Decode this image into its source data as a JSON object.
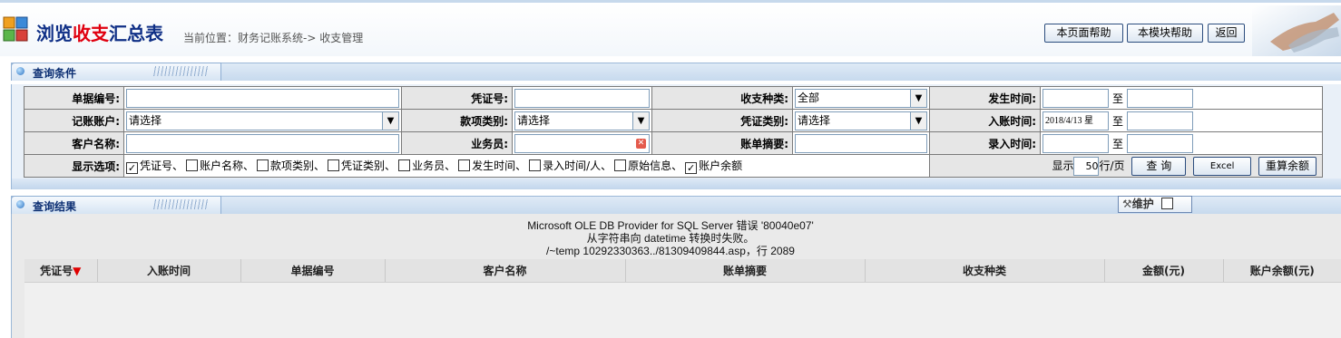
{
  "header": {
    "title_part1": "浏览",
    "title_part2": "收支",
    "title_part3": "汇总表",
    "breadcrumb": "当前位置：财务记账系统-> 收支管理",
    "buttons": {
      "page_help": "本页面帮助",
      "module_help": "本模块帮助",
      "back": "返回"
    }
  },
  "query": {
    "section_title": "查询条件",
    "labels": {
      "doc_no": "单据编号:",
      "voucher_no": "凭证号:",
      "io_type": "收支种类:",
      "occur_time": "发生时间:",
      "account": "记账账户:",
      "item_type": "款项类别:",
      "voucher_type": "凭证类别:",
      "post_time": "入账时间:",
      "customer": "客户名称:",
      "salesman": "业务员:",
      "summary": "账单摘要:",
      "entry_time": "录入时间:",
      "display_opts": "显示选项:"
    },
    "values": {
      "doc_no": "",
      "voucher_no": "",
      "io_type": "全部",
      "account": "请选择",
      "item_type": "请选择",
      "voucher_type": "请选择",
      "post_time_from": "2018/4/13 星",
      "customer": "",
      "salesman": "",
      "summary": ""
    },
    "to_text": "至",
    "options": [
      {
        "label": "凭证号、",
        "checked": true
      },
      {
        "label": "账户名称、",
        "checked": false
      },
      {
        "label": "款项类别、",
        "checked": false
      },
      {
        "label": "凭证类别、",
        "checked": false
      },
      {
        "label": "业务员、",
        "checked": false
      },
      {
        "label": "发生时间、",
        "checked": false
      },
      {
        "label": "录入时间/人、",
        "checked": false
      },
      {
        "label": "原始信息、",
        "checked": false
      },
      {
        "label": "账户余额",
        "checked": true
      }
    ],
    "paging": {
      "show_label": "显示",
      "page_size": "50",
      "per_page_label": "行/页"
    },
    "buttons": {
      "search": "查 询",
      "excel": "Excel",
      "recalc": "重算余额"
    }
  },
  "results": {
    "section_title": "查询结果",
    "maintain_label": "维护",
    "error_lines": [
      "Microsoft OLE DB Provider for SQL Server 错误 '80040e07'",
      "从字符串向 datetime 转换时失败。",
      "/~temp 10292330363../81309409844.asp，行 2089"
    ],
    "columns": [
      "凭证号",
      "入账时间",
      "单据编号",
      "客户名称",
      "账单摘要",
      "收支种类",
      "金额(元)",
      "账户余额(元)"
    ],
    "sort_indicator": "▼"
  }
}
